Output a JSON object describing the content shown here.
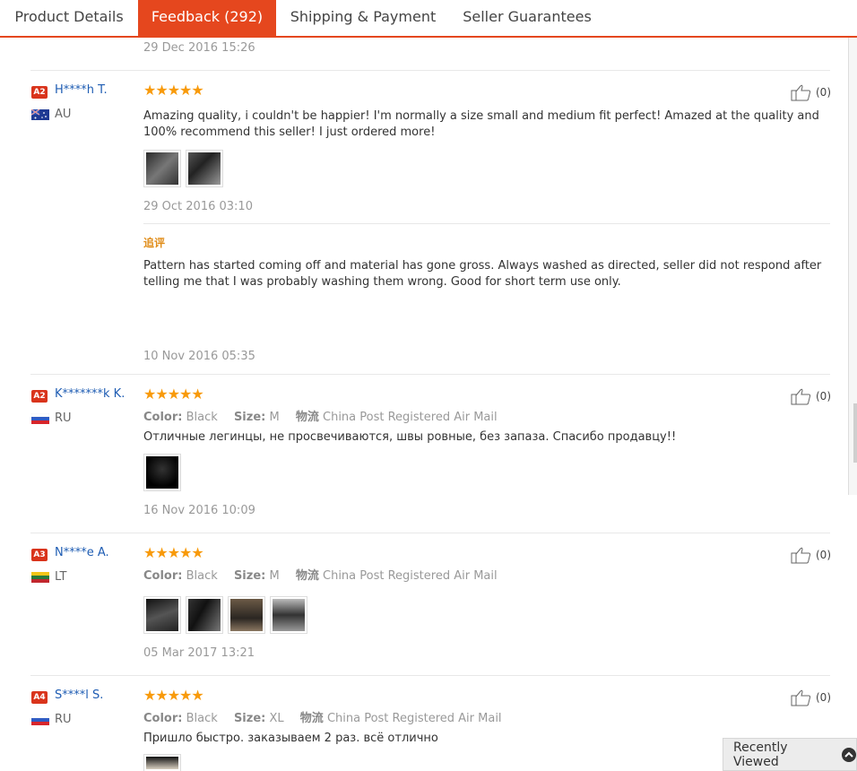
{
  "tabs": [
    {
      "label": "Product Details"
    },
    {
      "label": "Feedback (292)"
    },
    {
      "label": "Shipping & Payment"
    },
    {
      "label": "Seller Guarantees"
    }
  ],
  "top_date": "29 Dec 2016 15:26",
  "reviews": [
    {
      "badge": "A2",
      "badge_color": "#d9341c",
      "name": "H****h T.",
      "country": "AU",
      "stars": "★★★★★",
      "likes": "(0)",
      "text": "Amazing quality, i couldn't be happier! I'm normally a size small and medium fit perfect! Amazed at the quality and 100% recommend this seller! I just ordered more!",
      "date": "29 Oct 2016 03:10",
      "additional_label": "追评",
      "additional_text": "Pattern has started coming off and material has gone gross. Always washed as directed, seller did not respond after telling me that I was probably washing them wrong. Good for short term use only.",
      "additional_date": "10 Nov 2016 05:35"
    },
    {
      "badge": "A2",
      "badge_color": "#d9341c",
      "name": "K*******k K.",
      "country": "RU",
      "stars": "★★★★★",
      "likes": "(0)",
      "color_label": "Color:",
      "color": "Black",
      "size_label": "Size:",
      "size": "M",
      "ship_label": "物流",
      "ship": "China Post Registered Air Mail",
      "text": "Отличные легинцы, не просвечиваются, швы ровные, без запаза. Спасибо продавцу!!",
      "date": "16 Nov 2016 10:09"
    },
    {
      "badge": "A3",
      "badge_color": "#d9341c",
      "name": "N****e A.",
      "country": "LT",
      "stars": "★★★★★",
      "likes": "(0)",
      "color_label": "Color:",
      "color": "Black",
      "size_label": "Size:",
      "size": "M",
      "ship_label": "物流",
      "ship": "China Post Registered Air Mail",
      "date": "05 Mar 2017 13:21"
    },
    {
      "badge": "A4",
      "badge_color": "#d9341c",
      "name": "S****l S.",
      "country": "RU",
      "stars": "★★★★★",
      "likes": "(0)",
      "color_label": "Color:",
      "color": "Black",
      "size_label": "Size:",
      "size": "XL",
      "ship_label": "物流",
      "ship": "China Post Registered Air Mail",
      "text": "Пришло быстро. заказываем 2 раз. всё отлично"
    }
  ],
  "recently_viewed": "Recently Viewed",
  "colors": {
    "accent": "#e5471e",
    "star": "#f89a0a",
    "link": "#1e5cb3"
  }
}
